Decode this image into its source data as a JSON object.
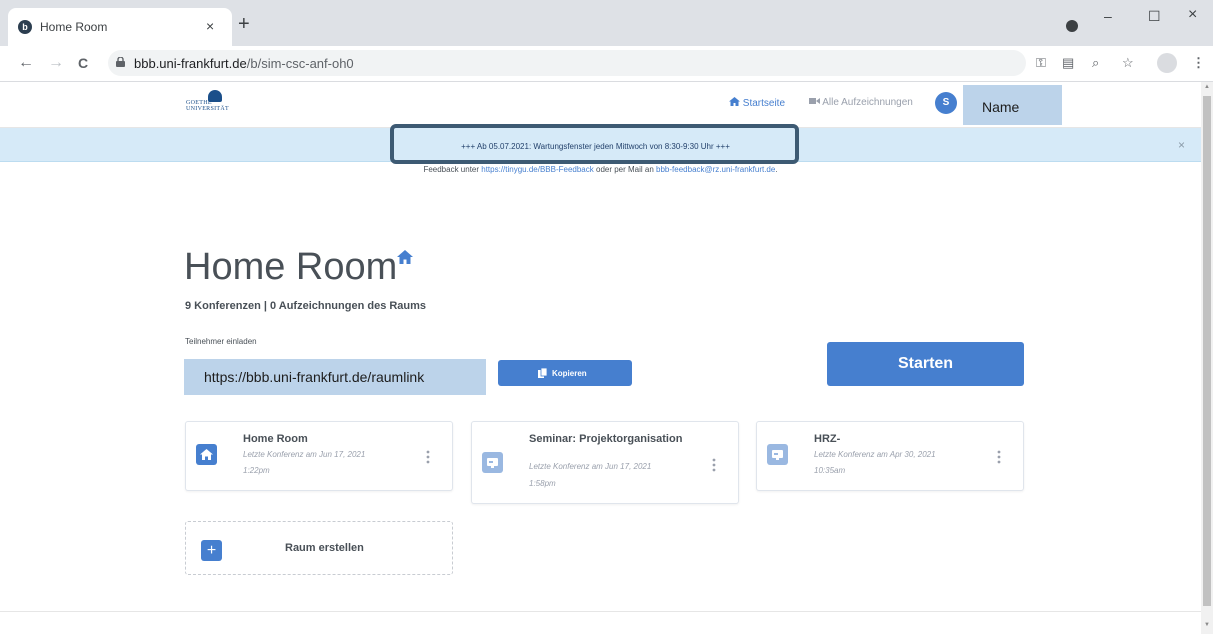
{
  "browser": {
    "tab_title": "Home Room",
    "tab_close": "×",
    "new_tab": "+",
    "url_host": "bbb.uni-frankfurt.de",
    "url_path": "/b/sim-csc-anf-oh0",
    "window": {
      "minimize": "–",
      "maximize": "☐",
      "close": "×"
    },
    "nav": {
      "back": "←",
      "forward": "→",
      "reload": "C"
    },
    "toolbar_icons": [
      "key-icon",
      "translate-icon",
      "zoom-icon",
      "star-icon",
      "profile-icon",
      "menu-icon"
    ]
  },
  "header": {
    "logo_line1": "GOETHE",
    "logo_line2": "UNIVERSITÄT",
    "nav_home": "Startseite",
    "nav_recordings": "Alle Aufzeichnungen",
    "avatar_initial": "S",
    "user_name": "Name"
  },
  "banner": {
    "message": "+++ Ab 05.07.2021: Wartungsfenster jeden Mittwoch von 8:30-9:30 Uhr +++",
    "close": "×",
    "feedback_prefix": "Feedback unter ",
    "feedback_link": "https://tinygu.de/BBB-Feedback",
    "feedback_middle": " oder per Mail an ",
    "feedback_mail": "bbb-feedback@rz.uni-frankfurt.de",
    "feedback_suffix": "."
  },
  "room": {
    "title": "Home Room",
    "stats": "9 Konferenzen | 0 Aufzeichnungen des Raums",
    "invite_label": "Teilnehmer einladen",
    "invite_link": "https://bbb.uni-frankfurt.de/raumlink",
    "copy_label": "Kopieren",
    "start_label": "Starten"
  },
  "rooms": [
    {
      "title": "Home Room",
      "sub1": "Letzte Konferenz am Jun 17, 2021",
      "sub2": "1:22pm",
      "icon": "home-icon"
    },
    {
      "title": "Seminar: Projektorganisation",
      "sub1": "Letzte Konferenz am Jun 17, 2021",
      "sub2": "1:58pm",
      "icon": "room-icon"
    },
    {
      "title": "HRZ-",
      "sub1": "Letzte Konferenz am Apr 30, 2021",
      "sub2": "10:35am",
      "icon": "room-icon"
    }
  ],
  "create_room": {
    "icon": "+",
    "label": "Raum erstellen"
  },
  "colors": {
    "primary": "#467fcf",
    "banner_bg": "#d6eaf8",
    "highlight": "#bcd3ea",
    "outline": "#3d5a73"
  }
}
